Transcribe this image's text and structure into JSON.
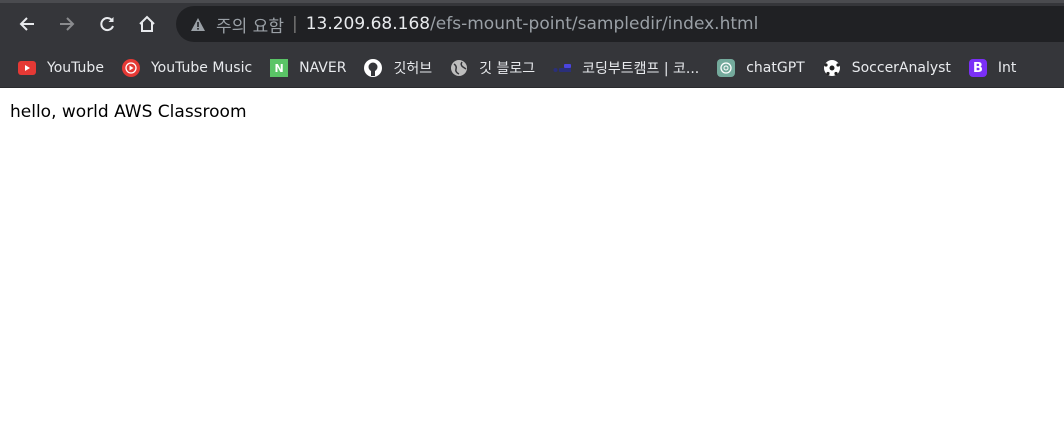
{
  "toolbar": {
    "warning_text": "주의 요함",
    "url_host": "13.209.68.168",
    "url_path": "/efs-mount-point/sampledir/index.html"
  },
  "bookmarks": [
    {
      "label": "YouTube",
      "icon": "youtube-icon",
      "color": "#e53935"
    },
    {
      "label": "YouTube Music",
      "icon": "youtube-music-icon",
      "color": "#e53935"
    },
    {
      "label": "NAVER",
      "icon": "naver-icon",
      "color": "#5ac466"
    },
    {
      "label": "깃허브",
      "icon": "github-icon",
      "color": "#ffffff"
    },
    {
      "label": "깃 블로그",
      "icon": "globe-icon",
      "color": "#bdbdbd"
    },
    {
      "label": "코딩부트캠프 | 코...",
      "icon": "codingbootcamp-icon",
      "color": "#3d3bd6"
    },
    {
      "label": "chatGPT",
      "icon": "chatgpt-icon",
      "color": "#74aa9c"
    },
    {
      "label": "SoccerAnalyst",
      "icon": "soccer-ball-icon",
      "color": "#ffffff"
    },
    {
      "label": "Int",
      "icon": "bootstrap-icon",
      "color": "#7b2ff7"
    }
  ],
  "page": {
    "text": "hello, world AWS Classroom"
  }
}
